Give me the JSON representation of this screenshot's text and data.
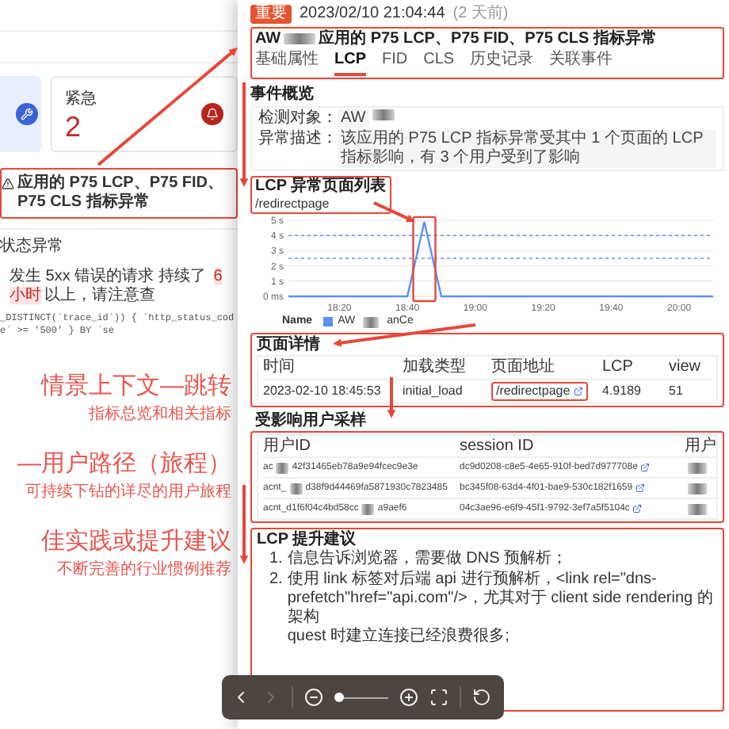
{
  "background_page": {
    "cards": [
      {
        "kind": "info"
      },
      {
        "kind": "urgent",
        "label": "紧急",
        "count": "2"
      }
    ],
    "alert": {
      "title": "应用的 P75 LCP、P75 FID、P75 CLS 指标异常",
      "highlighted": true
    },
    "status_heading": "状态异常",
    "message": [
      {
        "kind": "text",
        "text": "发生 5xx 错误的请求 持续了"
      },
      {
        "kind": "highlight",
        "text": "6 小时"
      },
      {
        "kind": "text",
        "text": "以上，请注意查"
      }
    ],
    "query": "_DISTINCT(`trace_id`)) { `http_status_code` >= '500' } BY `se"
  },
  "annotations": [
    {
      "title": "情景上下文—跳转",
      "subtitle": "指标总览和相关指标"
    },
    {
      "title": "—用户路径（旅程）",
      "subtitle": "可持续下钻的详尽的用户旅程"
    },
    {
      "title": "佳实践或提升建议",
      "subtitle": "不断完善的行业惯例推荐"
    }
  ],
  "drawer": {
    "badge": "重要",
    "time": "2023/02/10 21:04:44",
    "ago": "(2 天前)",
    "title_prefix": "AW",
    "title": "应用的 P75 LCP、P75 FID、P75 CLS 指标异常",
    "header_highlighted": true,
    "tabs": [
      {
        "label": "基础属性",
        "selected": false
      },
      {
        "label": "LCP",
        "selected": true
      },
      {
        "label": "FID",
        "selected": false
      },
      {
        "label": "CLS",
        "selected": false
      },
      {
        "label": "历史记录",
        "selected": false
      },
      {
        "label": "关联事件",
        "selected": false
      }
    ],
    "overview": {
      "heading": "事件概览",
      "fields": [
        {
          "label": "检测对象：",
          "value": "AW"
        },
        {
          "label": "异常描述：",
          "value": "该应用的 P75 LCP 指标异常受其中 1 个页面的 LCP 指标影响，有 3 个用户受到了影响"
        }
      ]
    },
    "page_list": {
      "heading": "LCP 异常页面列表",
      "highlighted": true,
      "page": "/redirectpage",
      "chart_data": {
        "type": "line",
        "categories": [
          null,
          null,
          null,
          "18:20",
          null,
          null,
          null,
          "18:40",
          null,
          null,
          null,
          "19:00",
          null,
          null,
          null,
          "19:20",
          null,
          null,
          null,
          "19:40",
          null,
          null,
          null,
          "20:00",
          null,
          null
        ],
        "series": [
          {
            "name": "AW",
            "color": "#5b8ff9",
            "values": [
              0,
              0,
              0,
              0,
              0,
              0,
              0,
              0,
              4.9,
              0,
              0,
              0,
              0,
              0,
              0,
              0,
              0,
              0,
              0,
              0,
              0,
              0,
              0,
              0,
              0,
              0
            ]
          },
          {
            "color": "#6b8ef0",
            "line_style": "dashed",
            "values": [
              4,
              4,
              4,
              4,
              4,
              4,
              4,
              4,
              4,
              4,
              4,
              4,
              4,
              4,
              4,
              4,
              4,
              4,
              4,
              4,
              4,
              4,
              4,
              4,
              4,
              4
            ]
          },
          {
            "color": "#6b8ef0",
            "line_style": "dashed",
            "values": [
              2.5,
              2.5,
              2.5,
              2.5,
              2.5,
              2.5,
              2.5,
              2.5,
              2.5,
              2.5,
              2.5,
              2.5,
              2.5,
              2.5,
              2.5,
              2.5,
              2.5,
              2.5,
              2.5,
              2.5,
              2.5,
              2.5,
              2.5,
              2.5,
              2.5,
              2.5
            ]
          }
        ],
        "ylim": [
          0,
          5
        ],
        "yticks": [
          {
            "value": 0,
            "label": "0 ms"
          },
          {
            "value": 1,
            "label": "1 s"
          },
          {
            "value": 2,
            "label": "2 s"
          },
          {
            "value": 3,
            "label": "3 s"
          },
          {
            "value": 4,
            "label": "4 s"
          },
          {
            "value": 5,
            "label": "5 s"
          }
        ],
        "grid": true
      },
      "legend": {
        "heading": "Name",
        "suffix": "anCe"
      }
    },
    "page_details": {
      "heading": "页面详情",
      "highlighted": true,
      "columns": [
        "时间",
        "加载类型",
        "页面地址",
        "LCP",
        "view"
      ],
      "rows": [
        {
          "time": "2023-02-10 18:45:53",
          "load_type": "initial_load",
          "url": "/redirectpage",
          "url_highlighted": true,
          "lcp": "4.9189",
          "views": "51"
        }
      ]
    },
    "users": {
      "heading": "受影响用户采样",
      "highlighted": true,
      "columns": [
        "用户ID",
        "session ID",
        "用户"
      ],
      "rows": [
        {
          "user_start": "ac",
          "user_end": "42f31465eb78a9e94fcec9e3e",
          "session": "dc9d0208-c8e5-4e65-910f-bed7d977708e"
        },
        {
          "user_start": "acnt_",
          "user_end": "d38f9d44469fa5871930c7823485",
          "session": "bc345f08-63d4-4f01-bae9-530c182f1659"
        },
        {
          "user_start": "acnt_d1f6f04c4bd58cc",
          "user_end": "a9aef6",
          "session": "04c3ae96-e6f9-45f1-9792-3ef7a5f5104c"
        }
      ]
    },
    "advice": {
      "heading": "LCP 提升建议",
      "highlighted": true,
      "items": [
        {
          "number": "1.",
          "lines": [
            "信息告诉浏览器，需要做 DNS 预解析；"
          ]
        },
        {
          "number": "2.",
          "lines": [
            "使用 link 标签对后端 api 进行预解析，<link rel=\"dns-prefetch\"href=\"api.com\"/>，尤其对于 client side rendering 的架构",
            "quest 时建立连接已经浪费很多;"
          ]
        }
      ]
    }
  },
  "viewer_toolbar": {
    "next_disabled": true,
    "zoom": {
      "level": 0.1
    }
  }
}
